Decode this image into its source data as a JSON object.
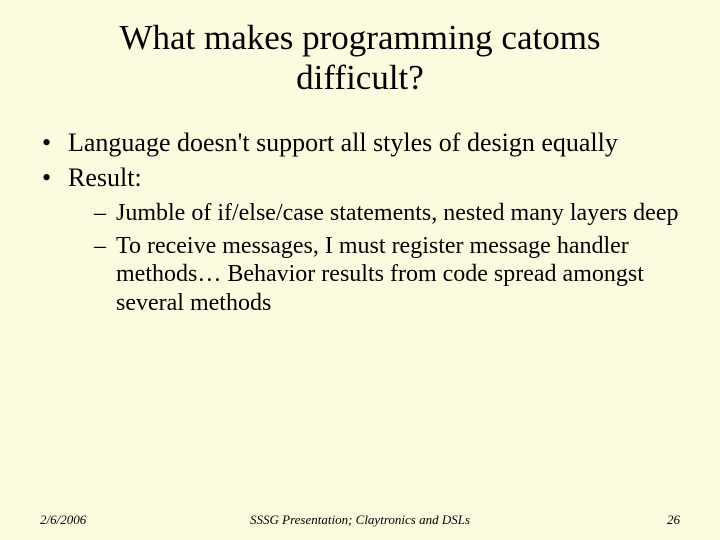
{
  "title": "What makes programming catoms difficult?",
  "bullets": {
    "b1": "Language doesn't support all styles of design equally",
    "b2": "Result:",
    "sub": {
      "s1": "Jumble of if/else/case statements, nested many layers deep",
      "s2": "To receive messages, I must register message handler methods… Behavior results from code spread amongst several methods"
    }
  },
  "footer": {
    "date": "2/6/2006",
    "center": "SSSG Presentation; Claytronics and DSLs",
    "page": "26"
  }
}
